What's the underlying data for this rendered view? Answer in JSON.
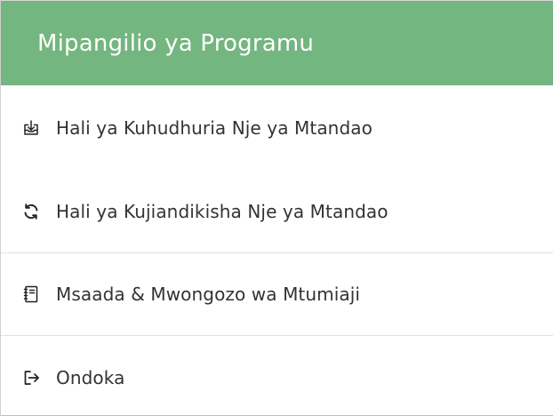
{
  "header": {
    "title": "Mipangilio ya Programu",
    "background_color": "#73b67f"
  },
  "menu": {
    "items": [
      {
        "label": "Hali ya Kuhudhuria Nje ya Mtandao",
        "icon": "download-tray-icon"
      },
      {
        "label": "Hali ya Kujiandikisha Nje ya Mtandao",
        "icon": "sync-icon"
      },
      {
        "label": "Msaada & Mwongozo wa Mtumiaji",
        "icon": "notebook-icon"
      },
      {
        "label": "Ondoka",
        "icon": "logout-icon"
      }
    ]
  }
}
